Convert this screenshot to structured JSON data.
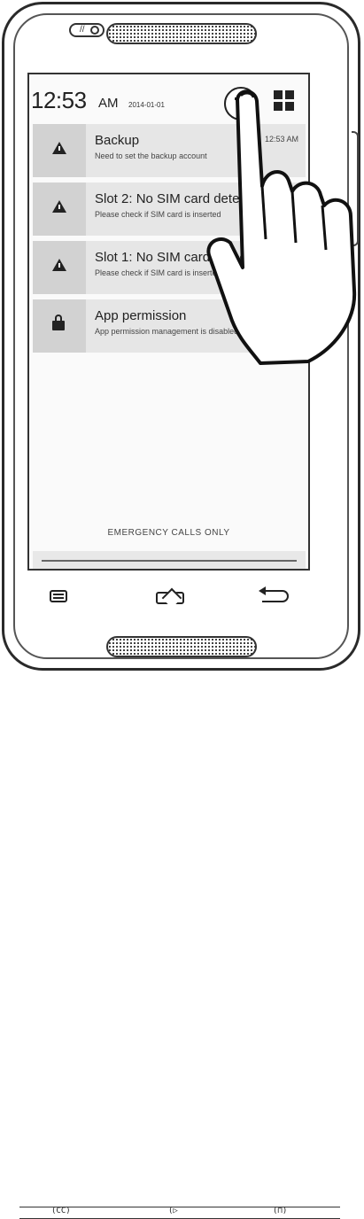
{
  "status_bar": {
    "time": "12:53",
    "ampm": "AM",
    "date": "2014-01-01"
  },
  "notifications": [
    {
      "icon": "warning-icon",
      "title": "Backup",
      "subtitle": "Need to set the backup account",
      "time": "12:53 AM"
    },
    {
      "icon": "warning-icon",
      "title": "Slot 2: No SIM card detected",
      "subtitle": "Please check if SIM card is inserted"
    },
    {
      "icon": "warning-icon",
      "title": "Slot 1: No SIM card detected",
      "subtitle": "Please check if SIM card is inserted"
    },
    {
      "icon": "lock-icon",
      "title": "App permission",
      "subtitle": "App permission management is disabled"
    }
  ],
  "emergency_text": "EMERGENCY CALLS ONLY",
  "icons": {
    "quick_settings": "notification-toggle-icon",
    "grid": "quick-settings-grid-icon",
    "menu": "menu-key-icon",
    "home": "home-key-icon",
    "back": "back-key-icon"
  },
  "key_labels": [
    "(CC)",
    "(▷",
    "(⊓)"
  ]
}
